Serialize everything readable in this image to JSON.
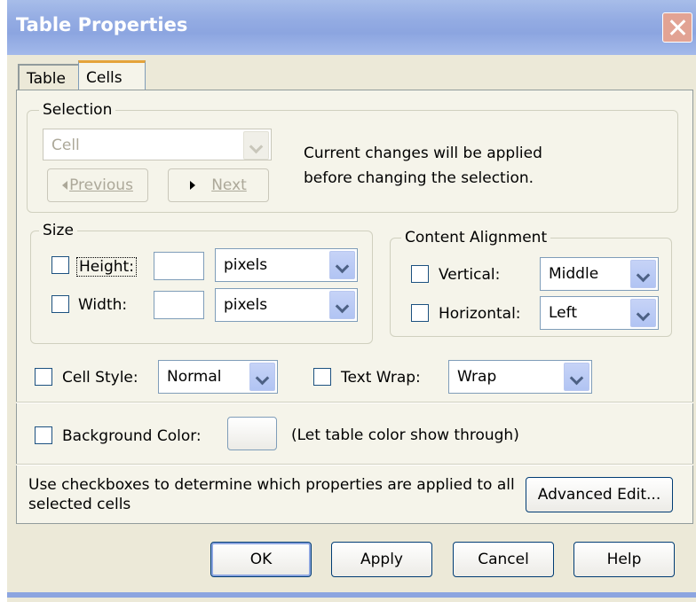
{
  "window": {
    "title": "Table Properties"
  },
  "tabs": [
    {
      "label": "Table"
    },
    {
      "label": "Cells"
    }
  ],
  "selection": {
    "legend": "Selection",
    "dropdown_value": "Cell",
    "previous_label": "Previous",
    "next_label": "Next",
    "info_line1": "Current changes will be applied",
    "info_line2": "before changing the selection."
  },
  "size": {
    "legend": "Size",
    "height_label": "Height:",
    "height_value": "",
    "height_unit": "pixels",
    "width_label": "Width:",
    "width_value": "",
    "width_unit": "pixels"
  },
  "alignment": {
    "legend": "Content Alignment",
    "vertical_label": "Vertical:",
    "vertical_value": "Middle",
    "horizontal_label": "Horizontal:",
    "horizontal_value": "Left"
  },
  "cell_style": {
    "label": "Cell Style:",
    "value": "Normal"
  },
  "text_wrap": {
    "label": "Text Wrap:",
    "value": "Wrap"
  },
  "background": {
    "label": "Background Color:",
    "note": "(Let table color show through)"
  },
  "hint": {
    "line1": "Use checkboxes to determine which properties are applied to all",
    "line2": "selected cells"
  },
  "buttons": {
    "advanced_edit": "Advanced Edit...",
    "ok": "OK",
    "apply": "Apply",
    "cancel": "Cancel",
    "help": "Help"
  },
  "colors": {
    "face": "#ECE9D8",
    "panel": "#F5F4EA",
    "title_blue": "#8CA5E0",
    "close_red": "#E2A394",
    "tab_highlight": "#E4A33A"
  }
}
